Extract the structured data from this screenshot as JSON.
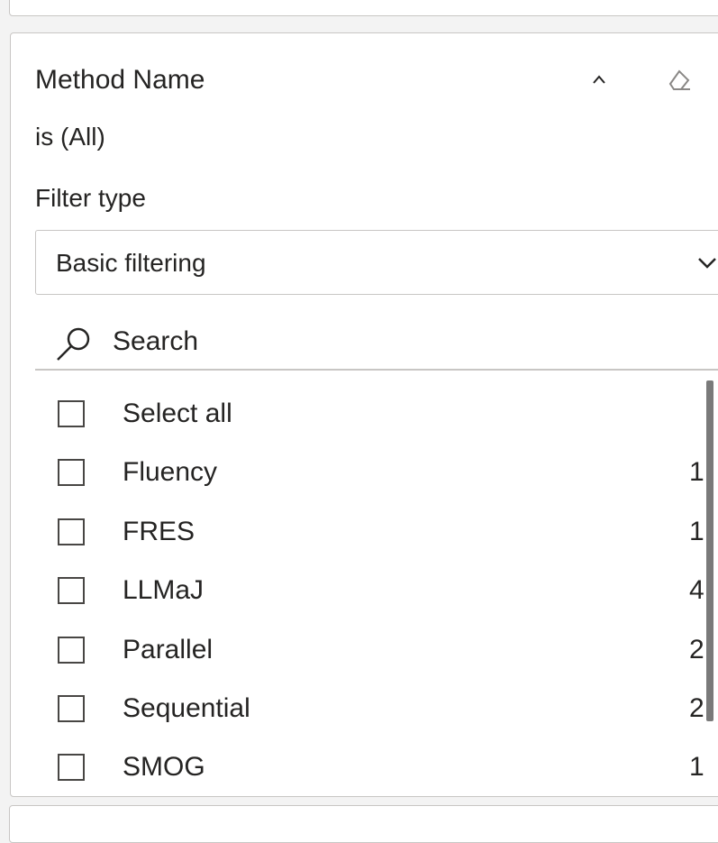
{
  "filter_card": {
    "title": "Method Name",
    "summary": "is (All)",
    "collapse_icon": "chevron-up-icon",
    "clear_icon": "eraser-icon",
    "filter_type": {
      "label": "Filter type",
      "selected": "Basic filtering",
      "icon": "chevron-down-icon"
    },
    "search": {
      "placeholder": "Search",
      "value": "",
      "icon": "search-icon"
    },
    "items": [
      {
        "label": "Select all",
        "count": "",
        "checked": false
      },
      {
        "label": "Fluency",
        "count": "1",
        "checked": false
      },
      {
        "label": "FRES",
        "count": "1",
        "checked": false
      },
      {
        "label": "LLMaJ",
        "count": "4",
        "checked": false
      },
      {
        "label": "Parallel",
        "count": "2",
        "checked": false
      },
      {
        "label": "Sequential",
        "count": "2",
        "checked": false
      },
      {
        "label": "SMOG",
        "count": "1",
        "checked": false
      }
    ]
  },
  "colors": {
    "card_background": "#ffffff",
    "page_background": "#f3f3f3",
    "border": "#c8c6c4",
    "text": "#252423",
    "scrollbar": "#7a7a7a"
  }
}
